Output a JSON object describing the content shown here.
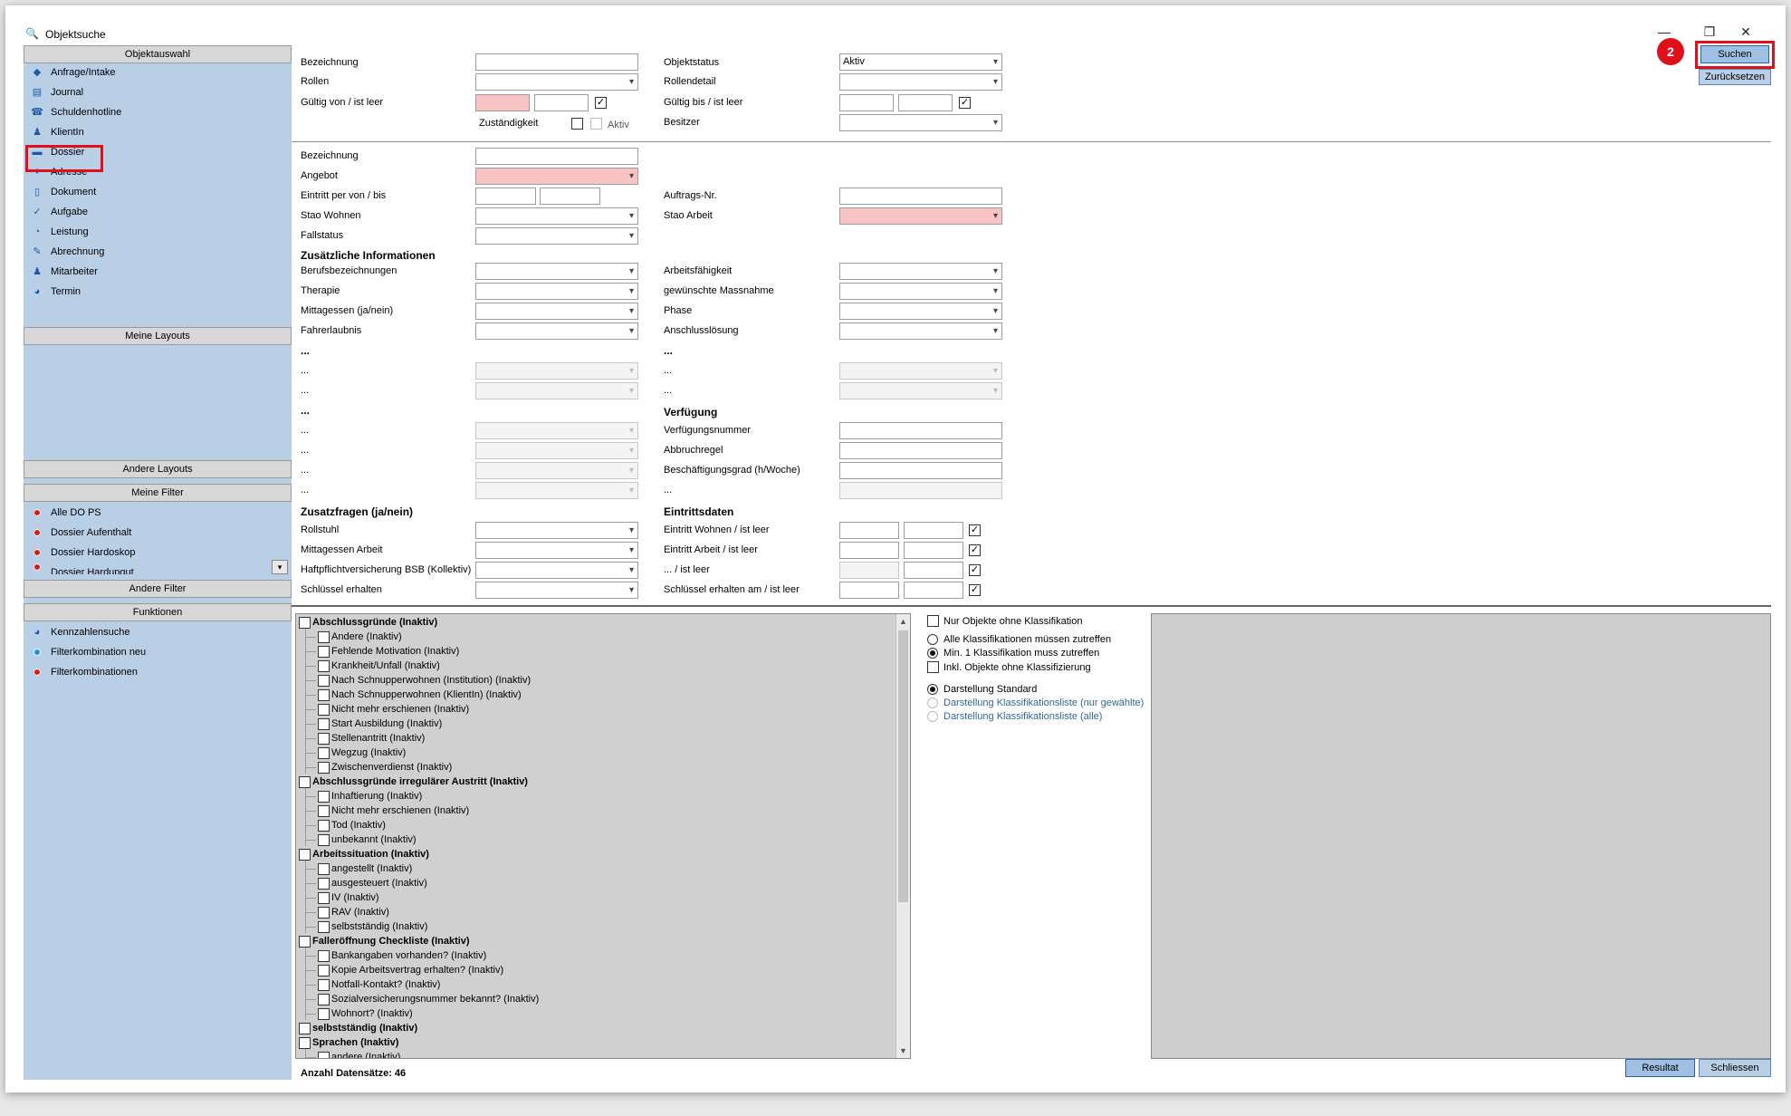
{
  "window": {
    "title": "Objektsuche",
    "minimize": "—",
    "restore": "❐",
    "close": "✕"
  },
  "sidebar": {
    "headers": {
      "objektauswahl": "Objektauswahl",
      "meine_layouts": "Meine Layouts",
      "andere_layouts": "Andere Layouts",
      "meine_filter": "Meine Filter",
      "andere_filter": "Andere Filter",
      "funktionen": "Funktionen"
    },
    "objects": [
      {
        "label": "Anfrage/Intake",
        "icon": "◆"
      },
      {
        "label": "Journal",
        "icon": "▤"
      },
      {
        "label": "Schuldenhotline",
        "icon": "☎"
      },
      {
        "label": "KlientIn",
        "icon": "♟"
      },
      {
        "label": "Dossier",
        "icon": "▬"
      },
      {
        "label": "Adresse",
        "icon": "✦"
      },
      {
        "label": "Dokument",
        "icon": "▯"
      },
      {
        "label": "Aufgabe",
        "icon": "✓"
      },
      {
        "label": "Leistung",
        "icon": "◔"
      },
      {
        "label": "Abrechnung",
        "icon": "✎"
      },
      {
        "label": "Mitarbeiter",
        "icon": "♟"
      },
      {
        "label": "Termin",
        "icon": "◕"
      }
    ],
    "filters": [
      "Alle DO PS",
      "Dossier Aufenthalt",
      "Dossier Hardoskop",
      "Dossier Hardupgut"
    ],
    "functions": [
      {
        "label": "Kennzahlensuche",
        "icon": "◕"
      },
      {
        "label": "Filterkombination neu",
        "icon": "●"
      },
      {
        "label": "Filterkombinationen",
        "icon": "●"
      }
    ]
  },
  "form": {
    "bezeichnung": "Bezeichnung",
    "rollen": "Rollen",
    "gueltig_von": "Gültig von / ist leer",
    "zustaendigkeit": "Zuständigkeit",
    "aktiv": "Aktiv",
    "objektstatus": "Objektstatus",
    "objektstatus_value": "Aktiv",
    "rollendetail": "Rollendetail",
    "gueltig_bis": "Gültig bis / ist leer",
    "besitzer": "Besitzer",
    "bezeichnung2": "Bezeichnung",
    "angebot": "Angebot",
    "eintritt_per": "Eintritt per von / bis",
    "stao_wohnen": "Stao Wohnen",
    "fallstatus": "Fallstatus",
    "auftrags_nr": "Auftrags-Nr.",
    "stao_arbeit": "Stao Arbeit",
    "zusaetzliche": "Zusätzliche Informationen",
    "berufsbezeichnungen": "Berufsbezeichnungen",
    "therapie": "Therapie",
    "mittagessen": "Mittagessen (ja/nein)",
    "fahrerlaubnis": "Fahrerlaubnis",
    "arbeitsfaehigkeit": "Arbeitsfähigkeit",
    "gewuenschte": "gewünschte Massnahme",
    "phase": "Phase",
    "anschlusslosung": "Anschlusslösung",
    "ellipsis": "...",
    "verfuegung": "Verfügung",
    "verfuegungsnummer": "Verfügungsnummer",
    "abbruchregel": "Abbruchregel",
    "beschaeftigungsgrad": "Beschäftigungsgrad (h/Woche)",
    "zusatzfragen": "Zusatzfragen (ja/nein)",
    "rollstuhl": "Rollstuhl",
    "mittagessen_arbeit": "Mittagessen Arbeit",
    "haftpflicht": "Haftpflichtversicherung BSB (Kollektiv)",
    "schluessel": "Schlüssel erhalten",
    "eintrittsdaten": "Eintrittsdaten",
    "eintritt_wohnen": "Eintritt Wohnen / ist leer",
    "eintritt_arbeit": "Eintritt Arbeit / ist leer",
    "ist_leer": "... / ist leer",
    "schluessel_am": "Schlüssel erhalten am / ist leer"
  },
  "tree": [
    {
      "label": "Abschlussgründe (Inaktiv)",
      "level": 0
    },
    {
      "label": "Andere (Inaktiv)",
      "level": 1
    },
    {
      "label": "Fehlende Motivation (Inaktiv)",
      "level": 1
    },
    {
      "label": "Krankheit/Unfall (Inaktiv)",
      "level": 1
    },
    {
      "label": "Nach Schnupperwohnen (Institution) (Inaktiv)",
      "level": 1
    },
    {
      "label": "Nach Schnupperwohnen (KlientIn) (Inaktiv)",
      "level": 1
    },
    {
      "label": "Nicht mehr erschienen (Inaktiv)",
      "level": 1
    },
    {
      "label": "Start Ausbildung (Inaktiv)",
      "level": 1
    },
    {
      "label": "Stellenantritt (Inaktiv)",
      "level": 1
    },
    {
      "label": "Wegzug (Inaktiv)",
      "level": 1
    },
    {
      "label": "Zwischenverdienst (Inaktiv)",
      "level": 1
    },
    {
      "label": "Abschlussgründe irregulärer Austritt (Inaktiv)",
      "level": 0
    },
    {
      "label": "Inhaftierung (Inaktiv)",
      "level": 1
    },
    {
      "label": "Nicht mehr erschienen (Inaktiv)",
      "level": 1
    },
    {
      "label": "Tod (Inaktiv)",
      "level": 1
    },
    {
      "label": "unbekannt (Inaktiv)",
      "level": 1
    },
    {
      "label": "Arbeitssituation (Inaktiv)",
      "level": 0
    },
    {
      "label": "angestellt (Inaktiv)",
      "level": 1
    },
    {
      "label": "ausgesteuert (Inaktiv)",
      "level": 1
    },
    {
      "label": "IV (Inaktiv)",
      "level": 1
    },
    {
      "label": "RAV (Inaktiv)",
      "level": 1
    },
    {
      "label": "selbstständig (Inaktiv)",
      "level": 1
    },
    {
      "label": "Falleröffnung Checkliste (Inaktiv)",
      "level": 0
    },
    {
      "label": "Bankangaben vorhanden? (Inaktiv)",
      "level": 1
    },
    {
      "label": "Kopie Arbeitsvertrag erhalten? (Inaktiv)",
      "level": 1
    },
    {
      "label": "Notfall-Kontakt? (Inaktiv)",
      "level": 1
    },
    {
      "label": "Sozialversicherungsnummer bekannt? (Inaktiv)",
      "level": 1
    },
    {
      "label": "Wohnort? (Inaktiv)",
      "level": 1
    },
    {
      "label": "selbstständig (Inaktiv)",
      "level": 0
    },
    {
      "label": "Sprachen (Inaktiv)",
      "level": 0
    },
    {
      "label": "andere (Inaktiv)",
      "level": 1
    }
  ],
  "classification": {
    "nur_objekte": "Nur Objekte ohne Klassifikation",
    "alle": "Alle Klassifikationen müssen zutreffen",
    "min1": "Min. 1 Klassifikation muss zutreffen",
    "inkl": "Inkl. Objekte ohne Klassifizierung",
    "standard": "Darstellung Standard",
    "liste_gewaehlt": "Darstellung Klassifikationsliste (nur gewählte)",
    "liste_alle": "Darstellung Klassifikationsliste (alle)"
  },
  "buttons": {
    "suchen": "Suchen",
    "zuruecksetzen": "Zurücksetzen",
    "resultat": "Resultat",
    "schliessen": "Schliessen"
  },
  "footer": {
    "anzahl": "Anzahl Datensätze: 46"
  },
  "badge": "2"
}
